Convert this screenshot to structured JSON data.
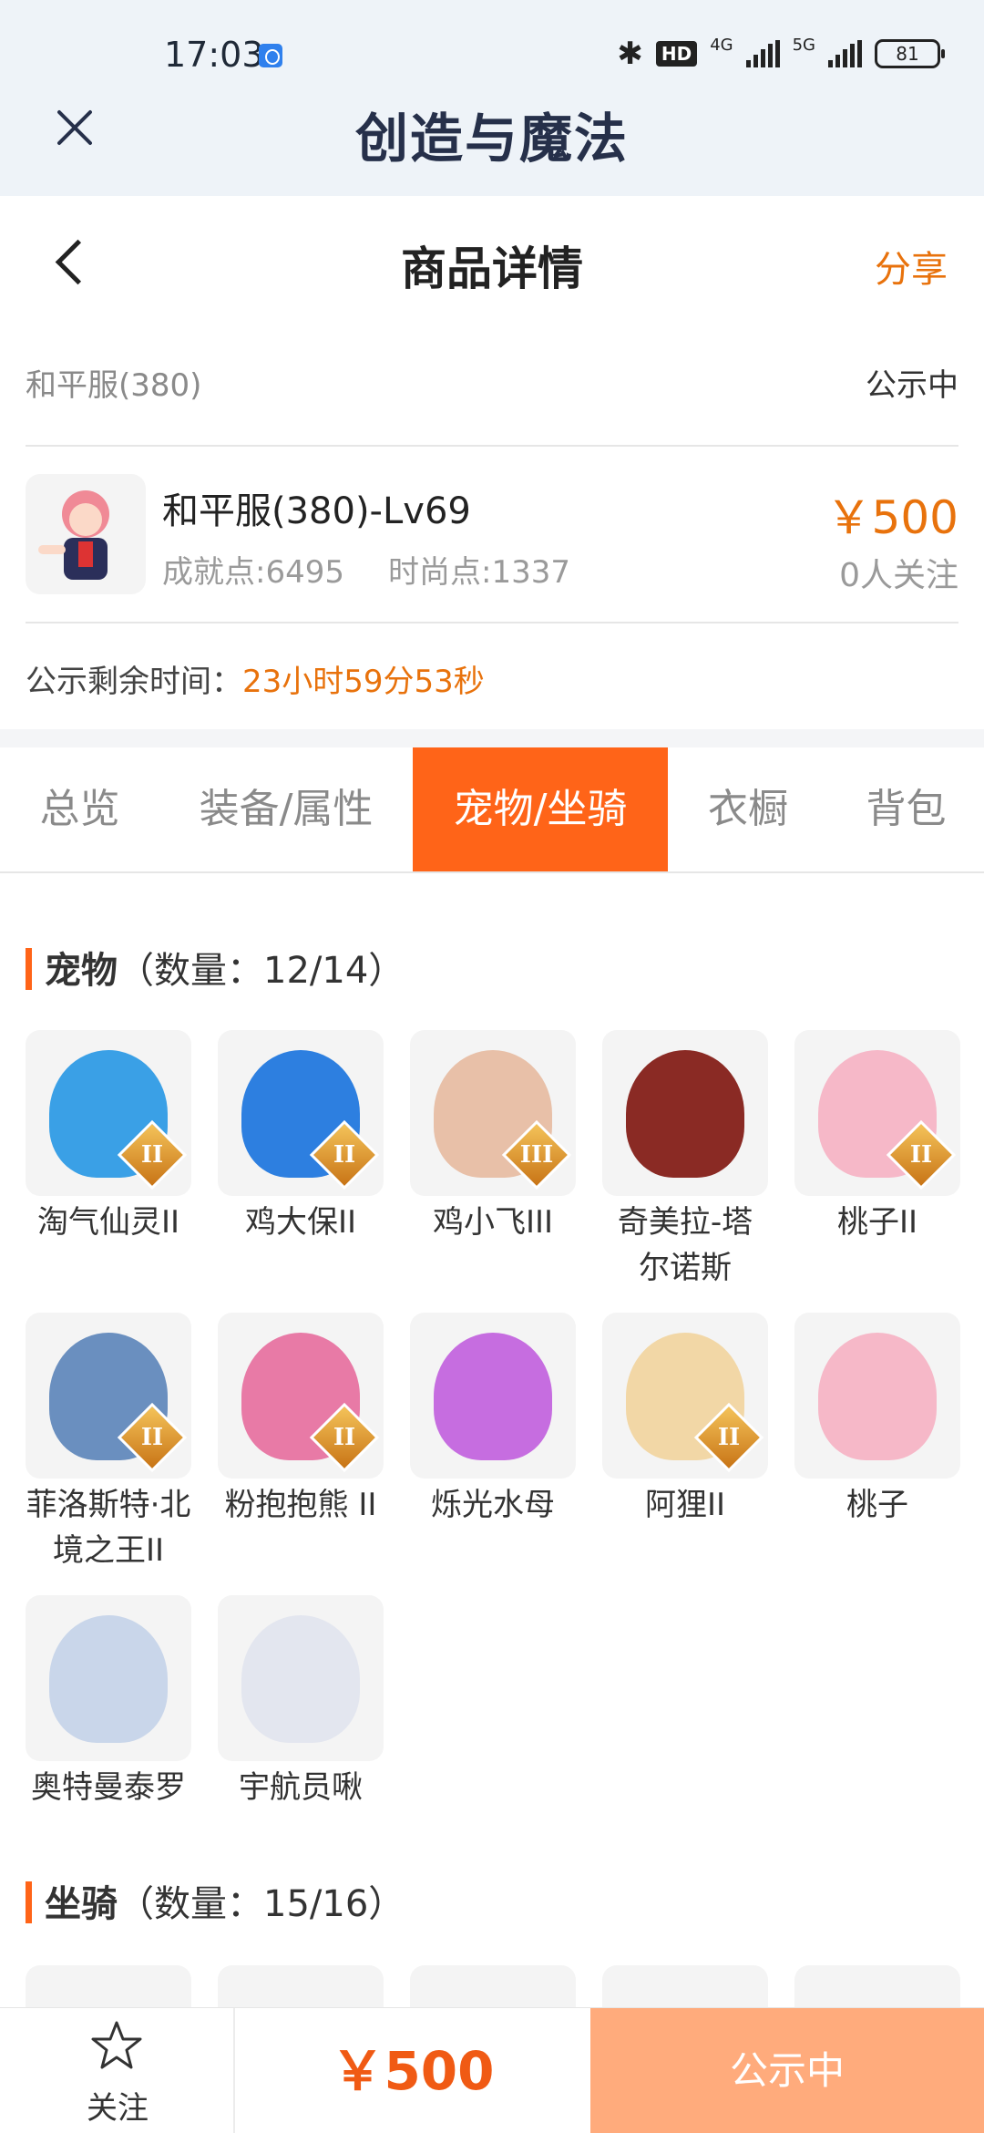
{
  "status_bar": {
    "time": "17:03",
    "hd": "HD",
    "net1": "4G",
    "net2": "5G",
    "battery": "81"
  },
  "app_bar": {
    "title": "创造与魔法"
  },
  "header": {
    "title": "商品详情",
    "share": "分享"
  },
  "server": {
    "name": "和平服(380)",
    "status": "公示中"
  },
  "character": {
    "name": "和平服(380)-Lv69",
    "achievement": "成就点:6495",
    "fashion": "时尚点:1337",
    "price": "￥500",
    "followers": "0人关注"
  },
  "remaining": {
    "label": "公示剩余时间：",
    "value": "23小时59分53秒"
  },
  "tabs": [
    "总览",
    "装备/属性",
    "宠物/坐骑",
    "衣橱",
    "背包"
  ],
  "active_tab": "宠物/坐骑",
  "pets_section": {
    "title": "宠物",
    "count": "（数量：12/14）"
  },
  "pets": [
    {
      "name": "淘气仙灵II",
      "badge": "II",
      "color": "#3aa0e6"
    },
    {
      "name": "鸡大保II",
      "badge": "II",
      "color": "#2d7fe0"
    },
    {
      "name": "鸡小飞III",
      "badge": "III",
      "color": "#e8c0a8"
    },
    {
      "name": "奇美拉-塔尔诺斯",
      "badge": "",
      "color": "#8a2a24"
    },
    {
      "name": "桃子II",
      "badge": "II",
      "color": "#f6b8c8"
    },
    {
      "name": "菲洛斯特·北境之王II",
      "badge": "II",
      "color": "#6a8fbf"
    },
    {
      "name": "粉抱抱熊 II",
      "badge": "II",
      "color": "#e87aa6"
    },
    {
      "name": "烁光水母",
      "badge": "",
      "color": "#c66de0"
    },
    {
      "name": "阿狸II",
      "badge": "II",
      "color": "#f2d7a6"
    },
    {
      "name": "桃子",
      "badge": "",
      "color": "#f6b8c8"
    },
    {
      "name": "奥特曼泰罗",
      "badge": "",
      "color": "#c9d6ea"
    },
    {
      "name": "宇航员啾",
      "badge": "",
      "color": "#e3e6ef"
    }
  ],
  "mounts_section": {
    "title": "坐骑",
    "count": "（数量：15/16）"
  },
  "bottom_bar": {
    "follow": "关注",
    "price": "￥500",
    "action": "公示中"
  }
}
